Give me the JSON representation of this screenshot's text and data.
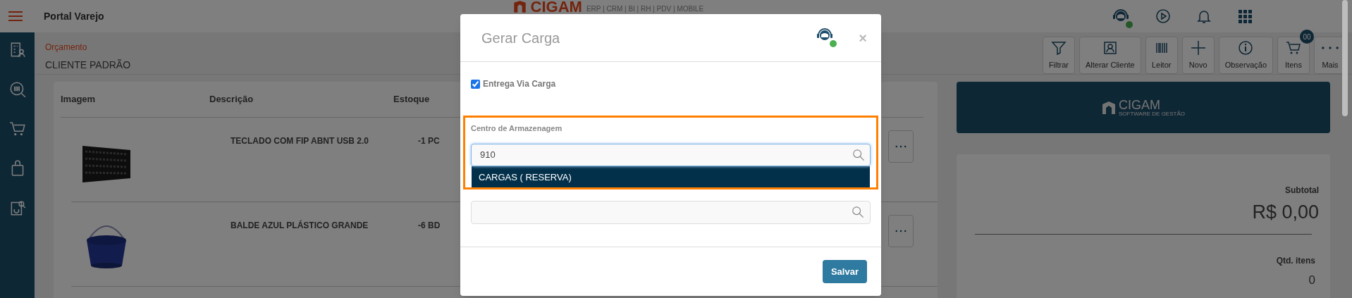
{
  "header": {
    "app_title": "Portal Varejo",
    "brand": {
      "name": "CIGAM",
      "tagline": "ERP | CRM | BI | RH | PDV | MOBILE"
    },
    "support_online": true
  },
  "page": {
    "breadcrumb": "Orçamento",
    "customer": "CLIENTE PADRÃO"
  },
  "toolbar": [
    {
      "label": "Filtrar"
    },
    {
      "label": "Alterar Cliente"
    },
    {
      "label": "Leitor"
    },
    {
      "label": "Novo"
    },
    {
      "label": "Observação"
    },
    {
      "label": "Itens",
      "badge": "00"
    },
    {
      "label": "Mais"
    }
  ],
  "table": {
    "columns": [
      "Imagem",
      "Descrição",
      "Estoque"
    ],
    "rows": [
      {
        "description": "TECLADO COM FIP ABNT USB 2.0",
        "stock": "-1 PC"
      },
      {
        "description": "BALDE AZUL PLÁSTICO GRANDE",
        "stock": "-6 BD"
      }
    ]
  },
  "summary": {
    "logo": {
      "name": "CIGAM",
      "tagline": "SOFTWARE DE GESTÃO"
    },
    "subtotal_label": "Subtotal",
    "subtotal": "R$ 0,00",
    "quantity_label": "Qtd. itens",
    "quantity": "0"
  },
  "modal": {
    "title": "Gerar Carga",
    "support_online": true,
    "close": "×",
    "checkbox": {
      "label": "Entrega Via Carga",
      "checked": true
    },
    "field": {
      "label": "Centro de Armazenagem",
      "value": "910"
    },
    "options": [
      {
        "label": "CARGAS ( RESERVA)",
        "selected": true
      }
    ],
    "button": "Salvar"
  }
}
